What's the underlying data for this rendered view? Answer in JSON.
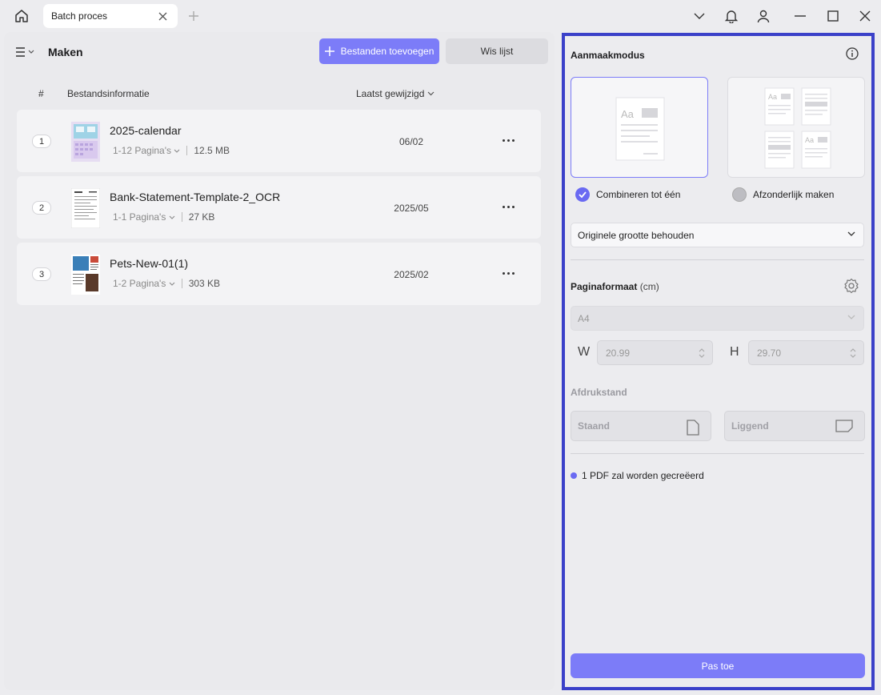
{
  "titlebar": {
    "tab_title": "Batch proces",
    "icons": [
      "home-icon",
      "close-icon",
      "plus-icon",
      "chevron-down-icon",
      "bell-icon",
      "user-icon",
      "minimize-icon",
      "maximize-icon",
      "close-window-icon"
    ]
  },
  "left": {
    "title": "Maken",
    "add_button": "Bestanden toevoegen",
    "clear_button": "Wis lijst",
    "columns": {
      "number": "#",
      "info": "Bestandsinformatie",
      "date": "Laatst gewijzigd"
    },
    "files": [
      {
        "index": "1",
        "name": "2025-calendar",
        "pages": "1-12 Pagina's",
        "size": "12.5 MB",
        "date": "06/02"
      },
      {
        "index": "2",
        "name": "Bank-Statement-Template-2_OCR",
        "pages": "1-1 Pagina's",
        "size": "27 KB",
        "date": "2025/05"
      },
      {
        "index": "3",
        "name": "Pets-New-01(1)",
        "pages": "1-2 Pagina's",
        "size": "303 KB",
        "date": "2025/02"
      }
    ]
  },
  "right": {
    "title": "Aanmaakmodus",
    "mode_combine": "Combineren tot één",
    "mode_separate": "Afzonderlijk maken",
    "size_select": "Originele grootte behouden",
    "page_format_label": "Paginaformaat",
    "page_format_unit": "(cm)",
    "paper_select": "A4",
    "w_label": "W",
    "w_value": "20.99",
    "h_label": "H",
    "h_value": "29.70",
    "orientation_label": "Afdrukstand",
    "portrait": "Staand",
    "landscape": "Liggend",
    "note": "1 PDF zal worden gecreëerd",
    "apply_button": "Pas toe"
  },
  "colors": {
    "accent": "#7c7cf8",
    "highlight_border": "#3b41c9",
    "radio_checked": "#6a6af2"
  }
}
